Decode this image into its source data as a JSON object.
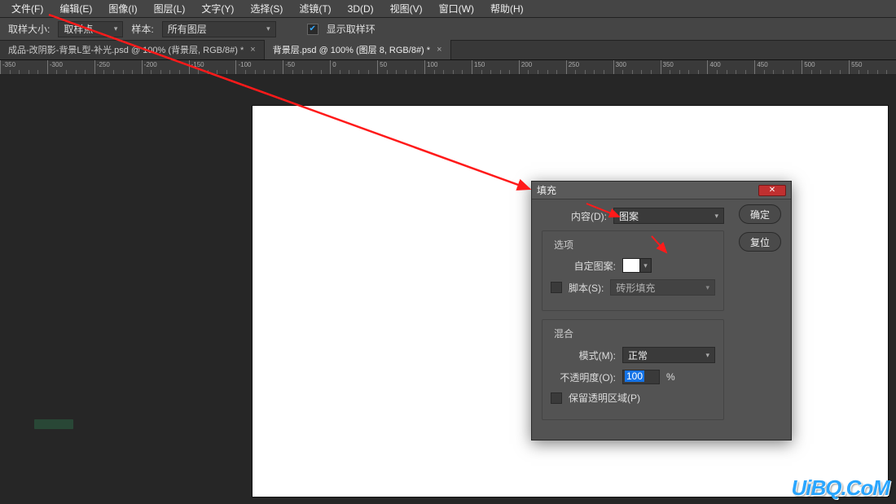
{
  "menu": {
    "items": [
      "文件(F)",
      "编辑(E)",
      "图像(I)",
      "图层(L)",
      "文字(Y)",
      "选择(S)",
      "滤镜(T)",
      "3D(D)",
      "视图(V)",
      "窗口(W)",
      "帮助(H)"
    ]
  },
  "options": {
    "sample_size_label": "取样大小:",
    "sample_size_value": "取样点",
    "sample_label": "样本:",
    "sample_value": "所有图层",
    "show_ring_label": "显示取样环"
  },
  "tabs": [
    {
      "label": "成品-改阴影-背景L型-补光.psd @ 100% (背景层, RGB/8#) *"
    },
    {
      "label": "背景层.psd @ 100% (图层 8, RGB/8#) *"
    }
  ],
  "ruler": {
    "start": -350,
    "end": 600,
    "step": 50
  },
  "dialog": {
    "title": "填充",
    "content_label": "内容(D):",
    "content_value": "图案",
    "options_legend": "选项",
    "custom_pattern_label": "自定图案:",
    "script_label": "脚本(S):",
    "script_value": "砖形填充",
    "blend_legend": "混合",
    "mode_label": "模式(M):",
    "mode_value": "正常",
    "opacity_label": "不透明度(O):",
    "opacity_value": "100",
    "opacity_unit": "%",
    "preserve_label": "保留透明区域(P)",
    "ok": "确定",
    "cancel": "复位"
  },
  "watermark": "UiBQ.CoM"
}
